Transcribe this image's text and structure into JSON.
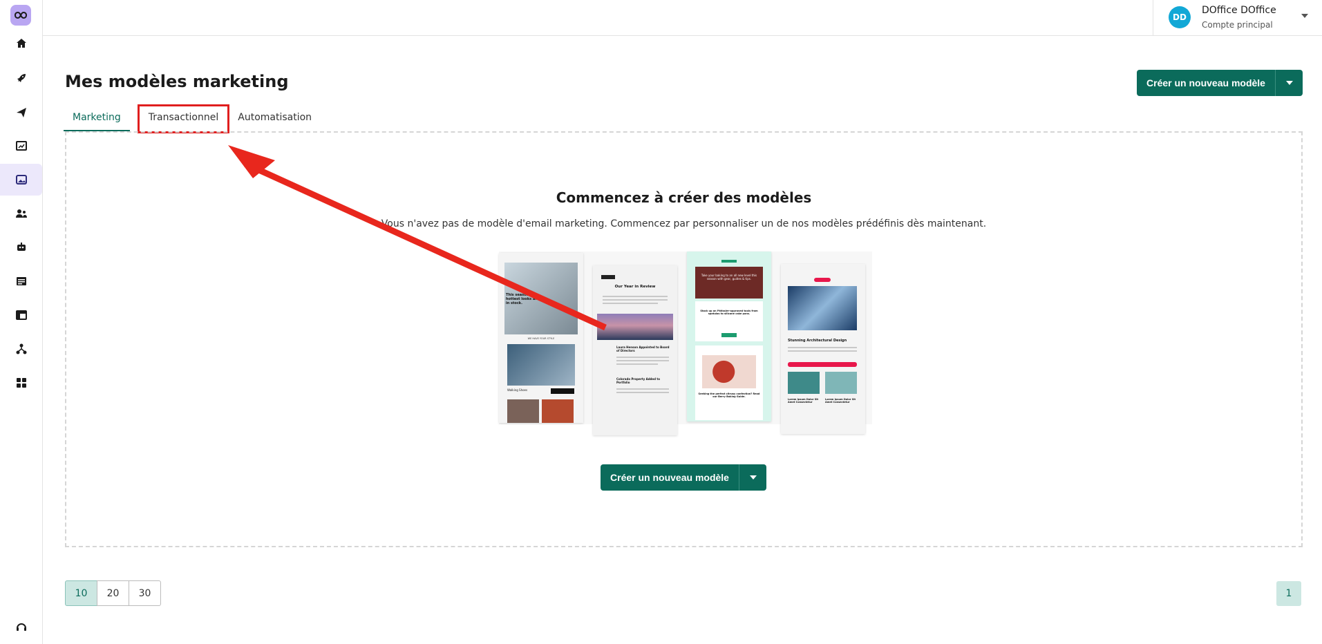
{
  "header": {
    "account": {
      "initials": "DD",
      "name": "DOffice DOffice",
      "subtitle": "Compte principal",
      "avatar_color": "#12a8d6"
    }
  },
  "sidebar": {
    "items": [
      {
        "icon": "home-icon"
      },
      {
        "icon": "rocket-icon"
      },
      {
        "icon": "paper-plane-icon"
      },
      {
        "icon": "chart-icon"
      },
      {
        "icon": "image-templates-icon",
        "active": true
      },
      {
        "icon": "contacts-icon"
      },
      {
        "icon": "robot-icon"
      },
      {
        "icon": "document-icon"
      },
      {
        "icon": "layout-icon"
      },
      {
        "icon": "workflow-icon"
      },
      {
        "icon": "apps-icon"
      }
    ],
    "bottom_icon": "support-icon"
  },
  "main": {
    "title": "Mes modèles marketing",
    "create_button": "Créer un nouveau modèle",
    "tabs": [
      {
        "label": "Marketing",
        "active": true
      },
      {
        "label": "Transactionnel",
        "highlighted": true
      },
      {
        "label": "Automatisation"
      }
    ],
    "empty_state": {
      "title": "Commencez à créer des modèles",
      "description": "Vous n'avez pas de modèle d'email marketing. Commencez par personnaliser un de nos modèles prédéfinis dès maintenant.",
      "create_button": "Créer un nouveau modèle",
      "preview_texts": {
        "card1_headline": "This season's hottest looks are in stock.",
        "card1_section": "WE HAVE YOUR STYLE",
        "card1_product": "Walking Shoes",
        "card2_title": "Our Year in Review",
        "card2_item1": "Laura Henson Appointed to Board of Directors",
        "card2_item2": "Colorado Property Added to Portfolio",
        "card3_headline": "Take your baking to an all new level this season with gear, guides & tips.",
        "card3_sub": "Stock up on Pâtissier-approved tools from spatulas to silicone cake pans.",
        "card3_footer": "Seeking the perfect citrusy confection? Read our Berry Baking Guide.",
        "card4_title": "Stunning Architectural Design",
        "card4_item1": "Lorem Ipsum Dolor Sit Amet Consectetur",
        "card4_item2": "Lorem Ipsum Dolor Sit Amet Consectetur"
      }
    }
  },
  "pagination": {
    "page_sizes": [
      "10",
      "20",
      "30"
    ],
    "selected_size": "10",
    "current_page": "1"
  },
  "colors": {
    "primary": "#0b6b5b",
    "highlight": "#e01e1e",
    "active_nav": "#ece8fb"
  }
}
